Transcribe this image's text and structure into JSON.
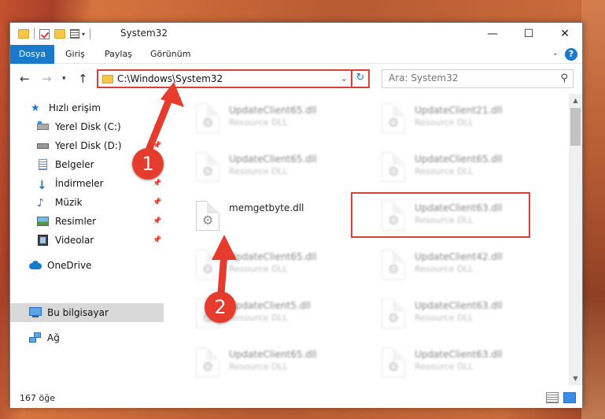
{
  "window": {
    "title": "System32",
    "minimize": "—",
    "maximize": "☐",
    "close": "✕"
  },
  "ribbon": {
    "tabs": [
      "Dosya",
      "Giriş",
      "Paylaş",
      "Görünüm"
    ],
    "help": "?"
  },
  "address": {
    "path": "C:\\Windows\\System32",
    "search_placeholder": "Ara: System32"
  },
  "nav": {
    "quick_access": "Hızlı erişim",
    "items": [
      {
        "label": "Yerel Disk (C:)",
        "icon": "drive-c-icon",
        "pinned": true
      },
      {
        "label": "Yerel Disk (D:)",
        "icon": "drive-icon",
        "pinned": true
      },
      {
        "label": "Belgeler",
        "icon": "documents-icon",
        "pinned": true
      },
      {
        "label": "İndirmeler",
        "icon": "downloads-icon",
        "pinned": true
      },
      {
        "label": "Müzik",
        "icon": "music-icon",
        "pinned": true
      },
      {
        "label": "Resimler",
        "icon": "pictures-icon",
        "pinned": true
      },
      {
        "label": "Videolar",
        "icon": "videos-icon",
        "pinned": true
      }
    ],
    "onedrive": "OneDrive",
    "this_pc": "Bu bilgisayar",
    "network": "Ağ"
  },
  "files": {
    "left": [
      {
        "name": "UpdateClient65.dll",
        "desc": "Resource DLL"
      },
      {
        "name": "UpdateClient65.dll",
        "desc": "Resource DLL"
      },
      {
        "name": "memgetbyte.dll",
        "desc": ""
      },
      {
        "name": "UpdateClient65.dll",
        "desc": "Resource DLL"
      },
      {
        "name": "UpdateClient5.dll",
        "desc": "Resource DLL"
      },
      {
        "name": "UpdateClient65.dll",
        "desc": "Resource DLL"
      }
    ],
    "right": [
      {
        "name": "UpdateClient21.dll",
        "desc": "Resource DLL"
      },
      {
        "name": "UpdateClient65.dll",
        "desc": "Resource DLL"
      },
      {
        "name": "UpdateClient63.dll",
        "desc": "Resource DLL"
      },
      {
        "name": "UpdateClient42.dll",
        "desc": "Resource DLL"
      },
      {
        "name": "UpdateClient63.dll",
        "desc": "Resource DLL"
      },
      {
        "name": "UpdateClient63.dll",
        "desc": "Resource DLL"
      }
    ]
  },
  "status": {
    "count": "167 öğe"
  },
  "annotations": {
    "step1": "1",
    "step2": "2",
    "color": "#e63c2e"
  }
}
